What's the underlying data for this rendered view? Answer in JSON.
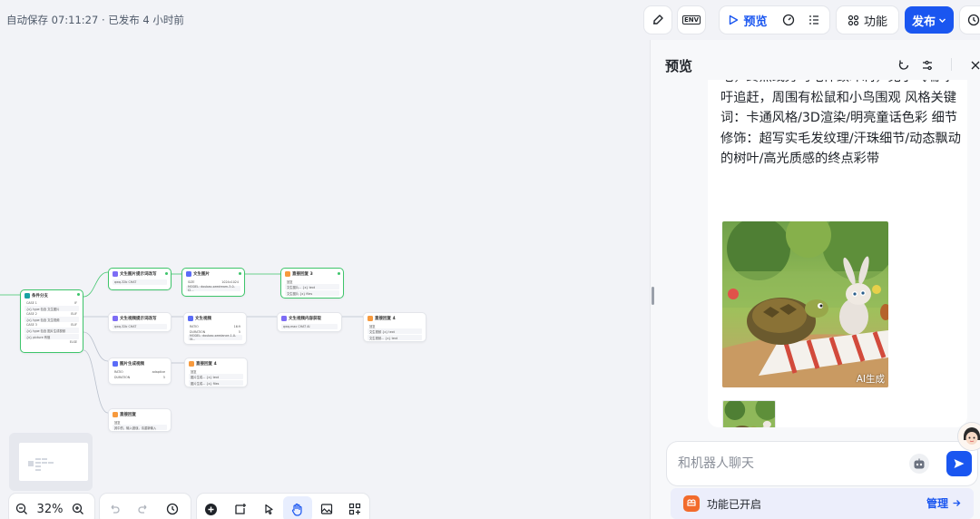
{
  "topbar": {
    "autosave": "自动保存 07:11:27 · 已发布 4 小时前",
    "preview_label": "预览",
    "features_label": "功能",
    "publish_label": "发布",
    "env_label": "ENV"
  },
  "canvas": {
    "zoom": "32%",
    "nodes": {
      "branch": {
        "title": "条件分支",
        "rows": [
          "CASE 1",
          "{x} type 包含 文生图片",
          "CASE 2",
          "{x} type 包含 文生视频",
          "CASE 3",
          "{x} type 包含 图片生成视频",
          "{x} picture 有值",
          "ELSE"
        ],
        "tags": [
          "IF",
          "ELIF",
          "ELIF",
          "ELSE"
        ]
      },
      "t2i_prompt": {
        "title": "文生图片提示词改写",
        "model": "qwq-32b",
        "tag": "CHAT"
      },
      "t2i": {
        "title": "文生图片",
        "size_label": "SIZE",
        "size_val": "1024x1024",
        "model": "MODEL: doubao-seedream-3-0-t2..."
      },
      "reply3": {
        "title": "直接回复 3",
        "label": "回复",
        "rows": [
          "文生图片...  {x} text",
          "文生图片  {x} files"
        ]
      },
      "t2v_prompt": {
        "title": "文生视频提示词改写",
        "model": "qwq-32b",
        "tag": "CHAT"
      },
      "t2v": {
        "title": "文生视频",
        "ratio_label": "RATIO",
        "ratio_val": "16:9",
        "dur_label": "DURATION",
        "dur_val": "5",
        "model": "MODEL: doubao-seedance-1-0-lit..."
      },
      "t2v_content": {
        "title": "文生视频内容获取",
        "model": "qwq-max",
        "tag": "CHAT",
        "tag2": "AI"
      },
      "reply4": {
        "title": "直接回复 4",
        "label": "回复",
        "rows": [
          "文生视频  {x} text",
          "文生视频...  {x} text"
        ]
      },
      "i2v": {
        "title": "图片生成视频",
        "ratio_label": "RATIO",
        "ratio_val": "adaptive",
        "dur_label": "DURATION",
        "dur_val": "5"
      },
      "reply4b": {
        "title": "直接回复 4",
        "label": "回复",
        "rows": [
          "图片生成...  {x} text",
          "图片生成...  {x} files"
        ]
      },
      "reply_else": {
        "title": "直接回复",
        "label": "回复",
        "rows": [
          "其中的，输入错误，请重新输入"
        ]
      }
    }
  },
  "panel": {
    "title": "预览",
    "message": "地，终点线旁乌龟伸颈冲刺，兔子气喘吁吁追赶，周围有松鼠和小鸟围观 风格关键词：卡通风格/3D渲染/明亮童话色彩 细节修饰：超写实毛发纹理/汗珠细节/动态飘动的树叶/高光质感的终点彩带",
    "ai_label": "AI生成",
    "input_placeholder": "和机器人聊天",
    "feature_text": "功能已开启",
    "manage_label": "管理"
  },
  "colors": {
    "accent": "#1a56f0",
    "selected": "#3ec56b",
    "feature_icon": "#f26b2c"
  }
}
